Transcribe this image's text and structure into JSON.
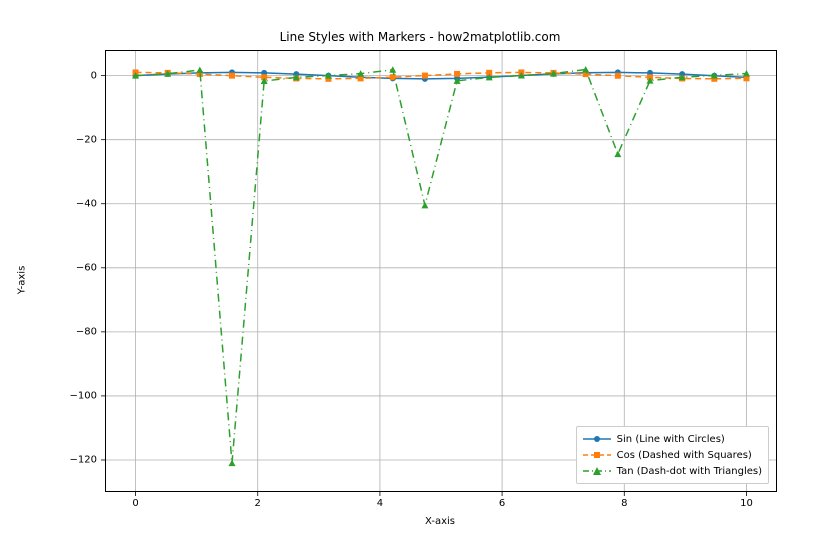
{
  "chart_data": {
    "type": "line",
    "title": "Line Styles with Markers - how2matplotlib.com",
    "xlabel": "X-axis",
    "ylabel": "Y-axis",
    "xlim": [
      -0.5,
      10.5
    ],
    "ylim": [
      -130,
      8
    ],
    "xticks": [
      0,
      2,
      4,
      6,
      8,
      10
    ],
    "yticks": [
      0,
      -20,
      -40,
      -60,
      -80,
      -100,
      -120
    ],
    "x": [
      0.0,
      0.5263,
      1.0526,
      1.5789,
      2.1053,
      2.6316,
      3.1579,
      3.6842,
      4.2105,
      4.7368,
      5.2632,
      5.7895,
      6.3158,
      6.8421,
      7.3684,
      7.8947,
      8.4211,
      8.9474,
      9.4737,
      10.0
    ],
    "series": [
      {
        "name": "Sin (Line with Circles)",
        "style": "solid",
        "marker": "circle",
        "color": "#1f77b4",
        "values": [
          0.0,
          0.5024,
          0.8687,
          1.0,
          0.8601,
          0.4862,
          -0.0166,
          -0.5184,
          -0.877,
          -0.9999,
          -0.8513,
          -0.4698,
          0.0332,
          0.5342,
          0.885,
          0.9995,
          0.8421,
          0.4532,
          -0.0498,
          -0.544
        ]
      },
      {
        "name": "Cos (Dashed with Squares)",
        "style": "dashed",
        "marker": "square",
        "color": "#ff7f0e",
        "values": [
          1.0,
          0.8647,
          0.4954,
          -0.0083,
          -0.5104,
          -0.8739,
          -0.9999,
          -0.8551,
          -0.4805,
          0.0166,
          0.5246,
          0.8828,
          0.9994,
          0.8454,
          0.4656,
          -0.0332,
          -0.5394,
          -0.8914,
          -0.9988,
          -0.8391
        ]
      },
      {
        "name": "Tan (Dash-dot with Triangles)",
        "style": "dashdot",
        "marker": "triangle",
        "color": "#2ca02c",
        "values": [
          0.0,
          0.581,
          1.7535,
          -121.0,
          -1.6853,
          -0.5564,
          0.0166,
          0.6063,
          1.8251,
          -40.5,
          -1.6223,
          -0.5322,
          0.0332,
          0.632,
          1.9007,
          -24.5,
          -1.5613,
          -0.5084,
          0.0498,
          0.6484
        ]
      }
    ],
    "legend_position": "lower right",
    "grid": true
  },
  "colors": {
    "gridline": "#b0b0b0",
    "spine": "#000000",
    "series1": "#1f77b4",
    "series2": "#ff7f0e",
    "series3": "#2ca02c",
    "legend_border": "#cccccc"
  }
}
